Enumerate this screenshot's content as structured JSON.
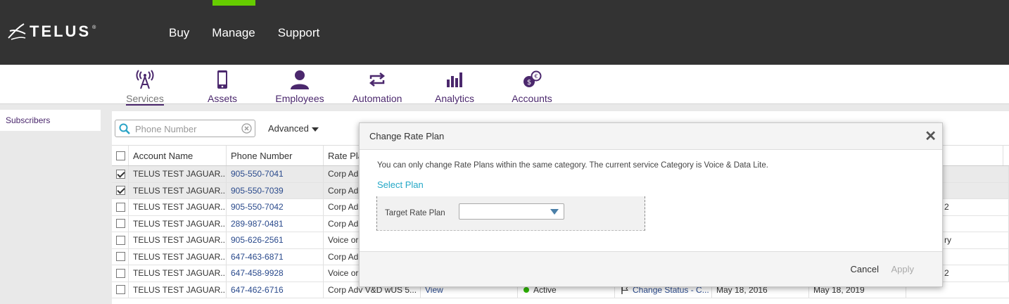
{
  "brand": {
    "name": "TELUS",
    "tm": "®",
    "accent_color": "#66cc00",
    "primary_color": "#4b286d"
  },
  "topnav": {
    "items": [
      "Buy",
      "Manage",
      "Support"
    ]
  },
  "subnav": {
    "items": [
      {
        "label": "Services",
        "icon": "antenna-icon"
      },
      {
        "label": "Assets",
        "icon": "mobile-phone-icon"
      },
      {
        "label": "Employees",
        "icon": "person-icon"
      },
      {
        "label": "Automation",
        "icon": "cycle-arrows-icon"
      },
      {
        "label": "Analytics",
        "icon": "bar-chart-icon"
      },
      {
        "label": "Accounts",
        "icon": "coins-icon"
      }
    ]
  },
  "left": {
    "item": "Subscribers"
  },
  "toolbar": {
    "search_placeholder": "Phone Number",
    "advanced": "Advanced"
  },
  "table": {
    "headers": [
      "Account Name",
      "Phone Number",
      "Rate Pla"
    ],
    "rows": [
      {
        "checked": true,
        "account": "TELUS TEST JAGUAR...",
        "phone": "905-550-7041",
        "rate": "Corp Ad",
        "extra": ""
      },
      {
        "checked": true,
        "account": "TELUS TEST JAGUAR...",
        "phone": "905-550-7039",
        "rate": "Corp Ad",
        "extra": ""
      },
      {
        "checked": false,
        "account": "TELUS TEST JAGUAR...",
        "phone": "905-550-7042",
        "rate": "Corp Ad",
        "extra": "2"
      },
      {
        "checked": false,
        "account": "TELUS TEST JAGUAR...",
        "phone": "289-987-0481",
        "rate": "Corp Ad",
        "extra": ""
      },
      {
        "checked": false,
        "account": "TELUS TEST JAGUAR...",
        "phone": "905-626-2561",
        "rate": "Voice or",
        "extra": "ry"
      },
      {
        "checked": false,
        "account": "TELUS TEST JAGUAR...",
        "phone": "647-463-6871",
        "rate": "Corp Ad",
        "extra": ""
      },
      {
        "checked": false,
        "account": "TELUS TEST JAGUAR...",
        "phone": "647-458-9928",
        "rate": "Voice or",
        "extra": "2"
      }
    ],
    "last_row": {
      "account": "TELUS TEST JAGUAR...",
      "phone": "647-462-6716",
      "rate": "Corp Adv V&D wUS 5...",
      "view": "View",
      "status": "Active",
      "action": "Change Status - C...",
      "date1": "May 18, 2016",
      "date2": "May 18, 2019"
    }
  },
  "modal": {
    "title": "Change Rate Plan",
    "close": "✕",
    "message": "You can only change Rate Plans within the same category. The current service Category is Voice & Data Lite.",
    "section": "Select Plan",
    "target_label": "Target Rate Plan",
    "target_value": "",
    "cancel": "Cancel",
    "apply": "Apply"
  }
}
